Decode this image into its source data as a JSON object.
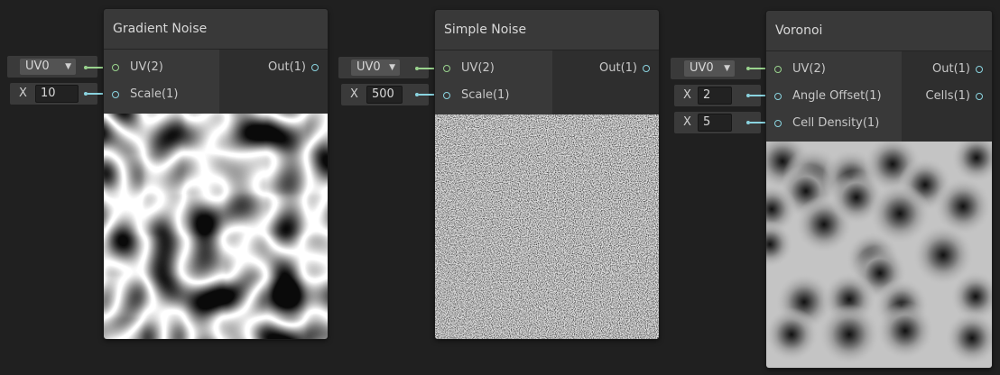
{
  "nodes": [
    {
      "title": "Gradient Noise",
      "inputs": [
        "UV(2)",
        "Scale(1)"
      ],
      "outputs": [
        "Out(1)"
      ],
      "uv_dropdown": "UV0",
      "fields": [
        {
          "label": "X",
          "value": "10"
        }
      ]
    },
    {
      "title": "Simple Noise",
      "inputs": [
        "UV(2)",
        "Scale(1)"
      ],
      "outputs": [
        "Out(1)"
      ],
      "uv_dropdown": "UV0",
      "fields": [
        {
          "label": "X",
          "value": "500"
        }
      ]
    },
    {
      "title": "Voronoi",
      "inputs": [
        "UV(2)",
        "Angle Offset(1)",
        "Cell Density(1)"
      ],
      "outputs": [
        "Out(1)",
        "Cells(1)"
      ],
      "uv_dropdown": "UV0",
      "fields": [
        {
          "label": "X",
          "value": "2"
        },
        {
          "label": "X",
          "value": "5"
        }
      ]
    }
  ],
  "colors": {
    "background": "#202020",
    "uv_port": "#9ad48e",
    "float_port": "#8ad4e0"
  },
  "icons": {
    "dropdown": "chevron-down-icon",
    "port": "port-dot-icon"
  }
}
